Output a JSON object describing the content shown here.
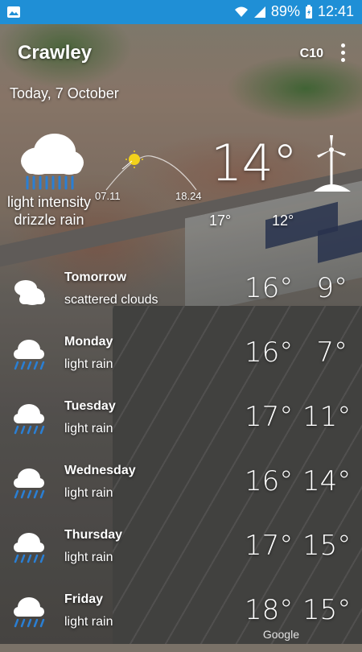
{
  "status_bar": {
    "battery": "89%",
    "time": "12:41",
    "icons": [
      "photo-notification-icon",
      "wifi-icon",
      "signal-icon",
      "battery-charging-icon"
    ]
  },
  "header": {
    "city": "Crawley",
    "code": "C10",
    "date": "Today, 7 October"
  },
  "current": {
    "icon": "drizzle-rain-icon",
    "description": "light intensity drizzle rain",
    "temperature": "14°",
    "sunrise": "07.11",
    "sunset": "18.24",
    "today_max": "17°",
    "today_min": "12°",
    "wind_icon": "wind-turbine-icon"
  },
  "forecast": [
    {
      "day": "Tomorrow",
      "condition": "scattered clouds",
      "high": "16°",
      "low": "9°",
      "icon": "scattered-clouds-icon"
    },
    {
      "day": "Monday",
      "condition": "light rain",
      "high": "16°",
      "low": "7°",
      "icon": "light-rain-icon"
    },
    {
      "day": "Tuesday",
      "condition": "light rain",
      "high": "17°",
      "low": "11°",
      "icon": "light-rain-icon"
    },
    {
      "day": "Wednesday",
      "condition": "light rain",
      "high": "16°",
      "low": "14°",
      "icon": "light-rain-icon"
    },
    {
      "day": "Thursday",
      "condition": "light rain",
      "high": "17°",
      "low": "15°",
      "icon": "light-rain-icon"
    },
    {
      "day": "Friday",
      "condition": "light rain",
      "high": "18°",
      "low": "15°",
      "icon": "light-rain-icon"
    }
  ],
  "attribution": "Google",
  "colors": {
    "status_bar": "#1f8fd6",
    "rain_drops": "#2a7fd4"
  }
}
